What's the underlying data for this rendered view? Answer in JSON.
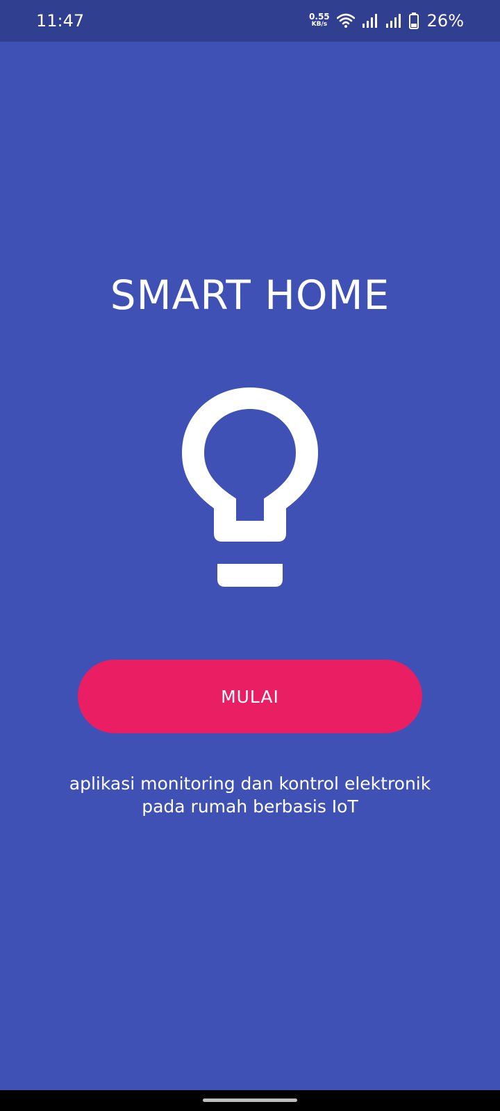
{
  "status_bar": {
    "time": "11:47",
    "net_speed_value": "0.55",
    "net_speed_unit": "KB/s",
    "battery_percent": "26%",
    "icons": [
      "wifi-icon",
      "signal-icon",
      "signal-icon",
      "battery-icon"
    ]
  },
  "main": {
    "title": "SMART HOME",
    "illustration_icon": "lightbulb-icon",
    "start_button_label": "MULAI",
    "description_line1": "aplikasi monitoring dan kontrol elektronik",
    "description_line2": "pada rumah berbasis IoT"
  },
  "colors": {
    "background": "#3f51b5",
    "status_bar": "#303f8f",
    "accent_button": "#e91e63",
    "text": "#ffffff"
  }
}
